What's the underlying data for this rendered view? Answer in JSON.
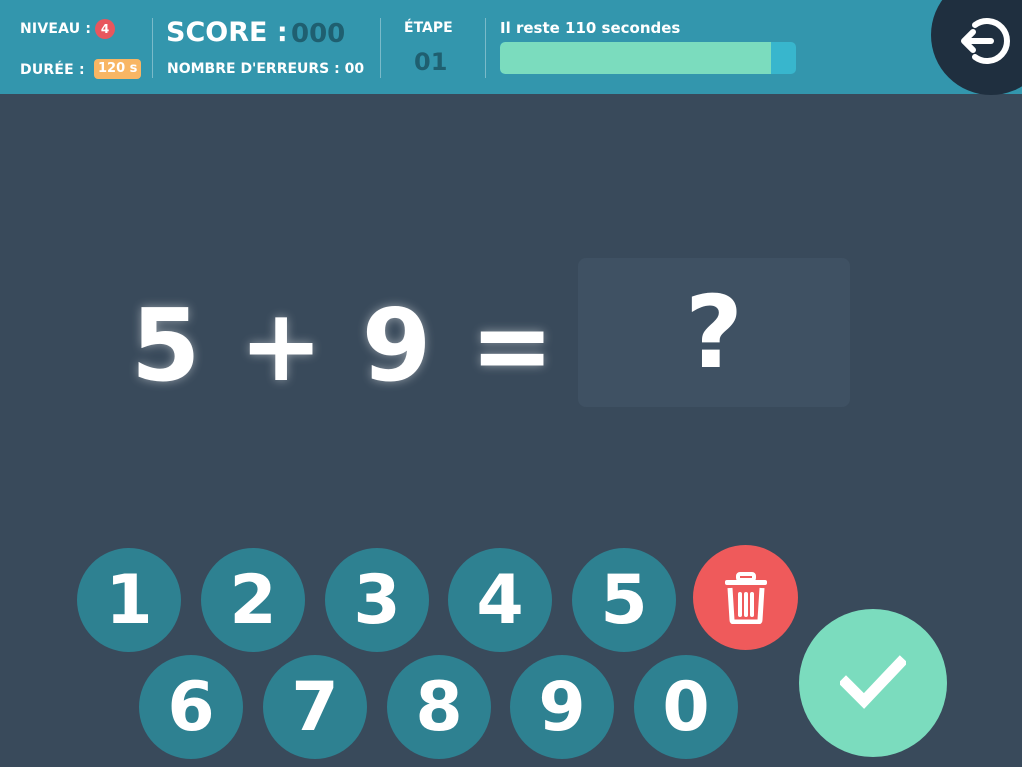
{
  "header": {
    "niveau_label": "NIVEAU :",
    "niveau_value": "4",
    "duree_label": "DURÉE :",
    "duree_value": "120 s",
    "score_label": "SCORE :",
    "score_value": "000",
    "errors_label": "NOMBRE D'ERREURS : 00",
    "etape_label": "ÉTAPE",
    "etape_value": "01",
    "time_remaining": "Il reste 110 secondes",
    "time_progress_fraction": 0.917,
    "exit_icon": "exit-icon"
  },
  "equation": {
    "text": "5 + 9 =",
    "answer_placeholder": "?"
  },
  "keypad": {
    "row1": [
      "1",
      "2",
      "3",
      "4",
      "5"
    ],
    "row2": [
      "6",
      "7",
      "8",
      "9",
      "0"
    ],
    "delete_icon": "trash-icon",
    "validate_icon": "checkmark-icon"
  },
  "colors": {
    "topbar": "#3396ad",
    "background": "#394a5b",
    "key": "#2e8191",
    "delete": "#ef5a5b",
    "validate": "#7bdcbe",
    "progress_fill": "#7bdcbe",
    "badge_red": "#e8565d",
    "badge_orange": "#f8b664"
  }
}
